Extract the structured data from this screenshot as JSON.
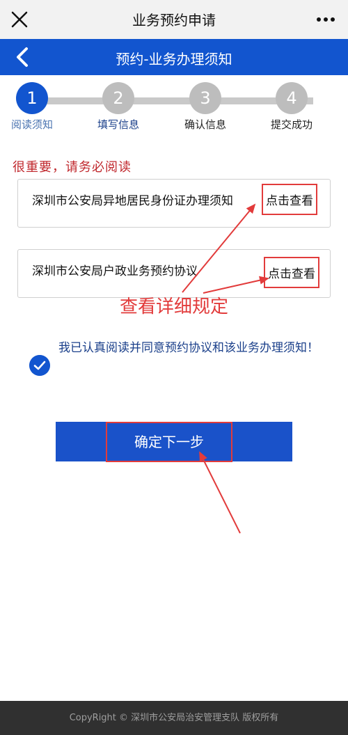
{
  "topbar": {
    "title": "业务预约申请",
    "close_icon": "close-icon",
    "more_icon": "more-icon"
  },
  "subbar": {
    "title": "预约-业务办理须知",
    "back_icon": "back-chevron-icon"
  },
  "steps": [
    {
      "number": "1",
      "label": "阅读须知",
      "active": true
    },
    {
      "number": "2",
      "label": "填写信息",
      "active": false
    },
    {
      "number": "3",
      "label": "确认信息",
      "active": false
    },
    {
      "number": "4",
      "label": "提交成功",
      "active": false
    }
  ],
  "notice": {
    "important": "很重要，请务必阅读"
  },
  "docs": [
    {
      "title": "深圳市公安局异地居民身份证办理须知",
      "action": "点击查看"
    },
    {
      "title": "深圳市公安局户政业务预约协议",
      "action": "点击查看"
    }
  ],
  "annotation": {
    "text": "查看详细规定"
  },
  "agreement": {
    "text": "我已认真阅读并同意预约协议和该业务办理须知！",
    "checked": true
  },
  "confirm": {
    "label": "确定下一步"
  },
  "footer": {
    "text": "CopyRight © 深圳市公安局治安管理支队 版权所有"
  },
  "colors": {
    "primary": "#1255cf",
    "annotation": "#e23b3b",
    "important": "#c0282d"
  }
}
